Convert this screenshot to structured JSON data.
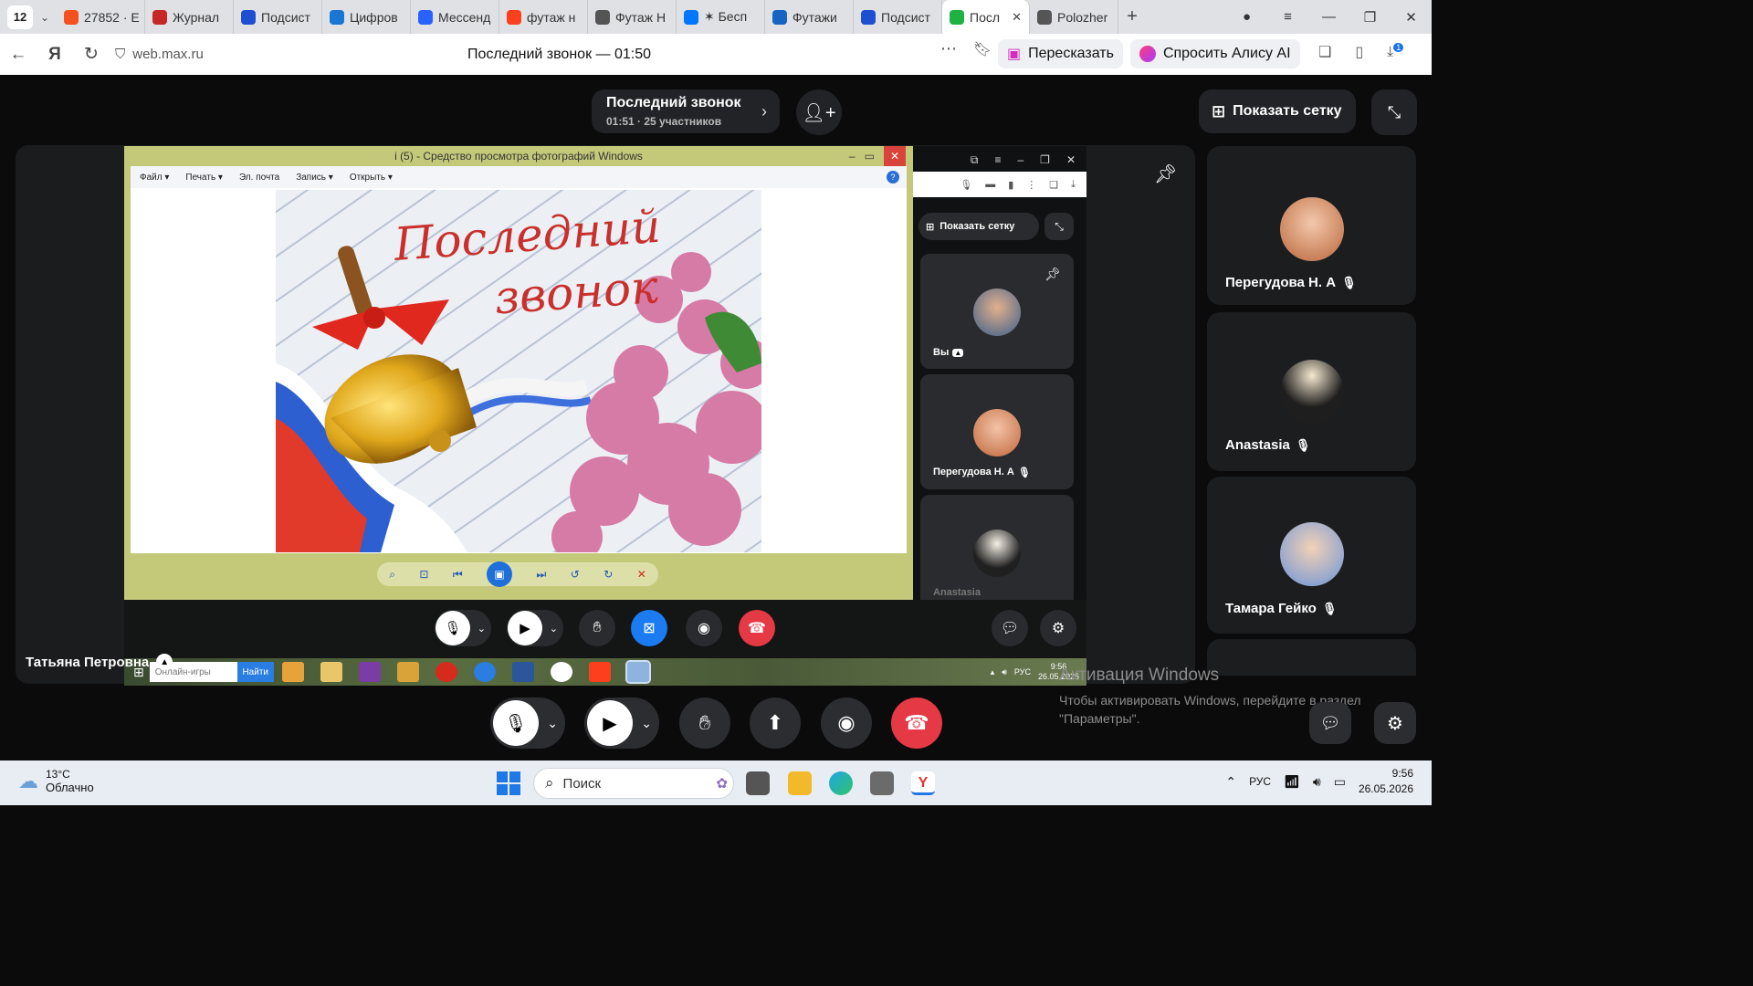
{
  "browser": {
    "tab_count": "12",
    "tabs": [
      {
        "label": "27852 · E",
        "color": "#f4511e"
      },
      {
        "label": "Журнал",
        "color": "#c62828"
      },
      {
        "label": "Подсист",
        "color": "#1e4fd1"
      },
      {
        "label": "Цифров",
        "color": "#1976d2"
      },
      {
        "label": "Мессенд",
        "color": "#2962ff"
      },
      {
        "label": "футаж н",
        "color": "#fc3f1d"
      },
      {
        "label": "Футаж Н",
        "color": "#555555"
      },
      {
        "label": "✶ Бесп",
        "color": "#0077ff"
      },
      {
        "label": "Футажи",
        "color": "#1565c0"
      },
      {
        "label": "Подсист",
        "color": "#1e4fd1"
      },
      {
        "label": "Посл",
        "color": "#1fb141",
        "active": true
      },
      {
        "label": "Polozher",
        "color": "#555555"
      }
    ],
    "url": "web.max.ru",
    "page_title": "Последний звонок — 01:50",
    "retell_label": "Пересказать",
    "alice_label": "Спросить Алису AI",
    "download_badge": "1"
  },
  "call": {
    "title": "Последний звонок",
    "subtitle": "01:51 · 25 участников",
    "show_grid_label": "Показать сетку",
    "presenter_name": "Татьяна Петровна"
  },
  "remote": {
    "viewer_title": "i (5) - Средство просмотра фотографий Windows",
    "menu": [
      "Файл ▾",
      "Печать ▾",
      "Эл. почта",
      "Запись ▾",
      "Открыть ▾"
    ],
    "image_text_line1": "Последний",
    "image_text_line2": "звонок",
    "mini_show_grid": "Показать сетку",
    "mini_you": "Вы",
    "mini_participant1": "Перегудова Н. А",
    "mini_participant2": "Anastasia",
    "taskbar_search_placeholder": "Онлайн-игры",
    "taskbar_search_button": "Найти",
    "taskbar_lang": "РУС",
    "taskbar_time": "9:56",
    "taskbar_date": "26.05.2026"
  },
  "participants": [
    {
      "name": "Перегудова Н. А",
      "avatar_color": "#c98a6a"
    },
    {
      "name": "Anastasia",
      "avatar_color": "#2d2a2a"
    },
    {
      "name": "Тамара Гейко",
      "avatar_color": "#7a9fd6"
    }
  ],
  "watermark": {
    "line1": "Активация Windows",
    "line2": "Чтобы активировать Windows, перейдите в раздел \"Параметры\"."
  },
  "taskbar": {
    "temperature": "13°C",
    "condition": "Облачно",
    "search_label": "Поиск",
    "lang": "РУС",
    "time": "9:56",
    "date": "26.05.2026"
  },
  "colors": {
    "hangup": "#e53946",
    "screen_share_active": "#1a7cf0",
    "background": "#0b0b0c"
  }
}
